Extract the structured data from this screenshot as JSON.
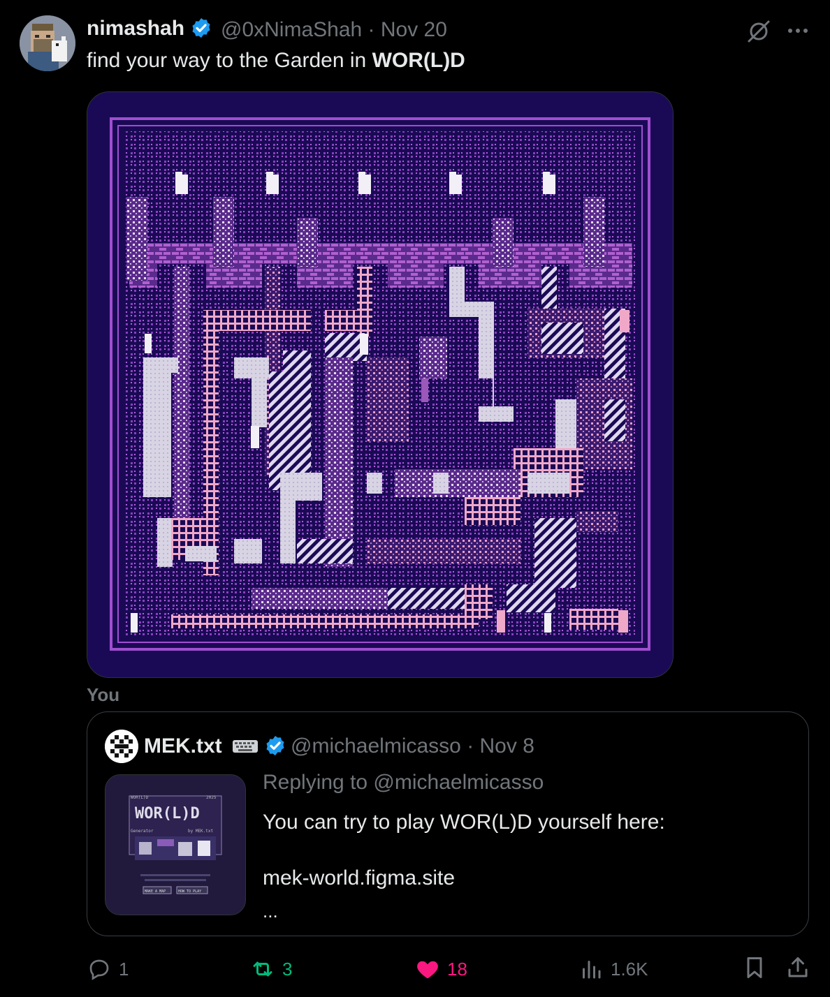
{
  "author": {
    "display_name": "nimashah",
    "handle_date": "@0xNimaShah · Nov 20",
    "avatar_icon": "avatar-pixel-portrait-icon"
  },
  "tweet": {
    "text_prefix": "find your way to the Garden in ",
    "text_bold": "WOR(L)D"
  },
  "media": {
    "description_icon": "pixel-maze-image"
  },
  "you_label": "You",
  "quote": {
    "display_name": "MEK.txt",
    "name_emoji": "⌨",
    "handle_date": "@michaelmicasso · Nov 8",
    "replying_to": "Replying to @michaelmicasso",
    "body_line1": "You can try to play WOR(L)D yourself here:",
    "body_line2": "mek-world.figma.site",
    "ellipsis": "...",
    "thumb": {
      "title_small": "WOR(L)D",
      "year": "2025",
      "logo": "WOR(L)D",
      "generator": "Generator",
      "by": "by MEK.txt",
      "button1": "MAKE A MAP",
      "button2": "HOW TO PLAY"
    }
  },
  "actions": {
    "reply_count": "1",
    "retweet_count": "3",
    "like_count": "18",
    "views_count": "1.6K"
  },
  "colors": {
    "verified": "#1d9bf0",
    "retweet_active": "#00ba7c",
    "like_active": "#f91880",
    "muted": "#71767b"
  }
}
